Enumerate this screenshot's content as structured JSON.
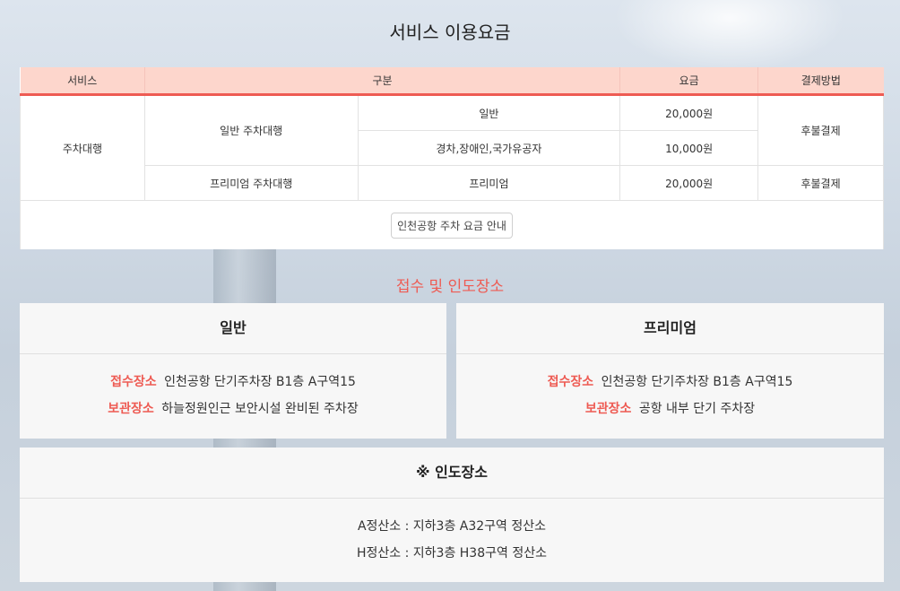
{
  "title": "서비스 이용요금",
  "table": {
    "headers": [
      "서비스",
      "구분",
      "요금",
      "결제방법"
    ],
    "service": "주차대행",
    "general_label": "일반 주차대행",
    "premium_label": "프리미엄 주차대행",
    "rows": [
      {
        "type": "일반",
        "price": "20,000원"
      },
      {
        "type": "경차,장애인,국가유공자",
        "price": "10,000원"
      },
      {
        "type": "프리미엄",
        "price": "20,000원"
      }
    ],
    "payment": [
      "후불결제",
      "후불결제"
    ],
    "guide_button": "인천공항 주차 요금 안내"
  },
  "section_title": "접수 및 인도장소",
  "general": {
    "title": "일반",
    "reception_label": "접수장소",
    "reception_value": "인천공항 단기주차장 B1층 A구역15",
    "storage_label": "보관장소",
    "storage_value": "하늘정원인근 보안시설 완비된 주차장"
  },
  "premium": {
    "title": "프리미엄",
    "reception_label": "접수장소",
    "reception_value": "인천공항 단기주차장 B1층 A구역15",
    "storage_label": "보관장소",
    "storage_value": "공항 내부 단기 주차장"
  },
  "delivery": {
    "title": "※ 인도장소",
    "lines": [
      "A정산소 : 지하3층 A32구역 정산소",
      "H정산소 : 지하3층 H38구역 정산소"
    ]
  },
  "colors": {
    "accent": "#ee5b53",
    "header_bg": "#fdd6cc",
    "card_bg": "#f7f7f7"
  }
}
